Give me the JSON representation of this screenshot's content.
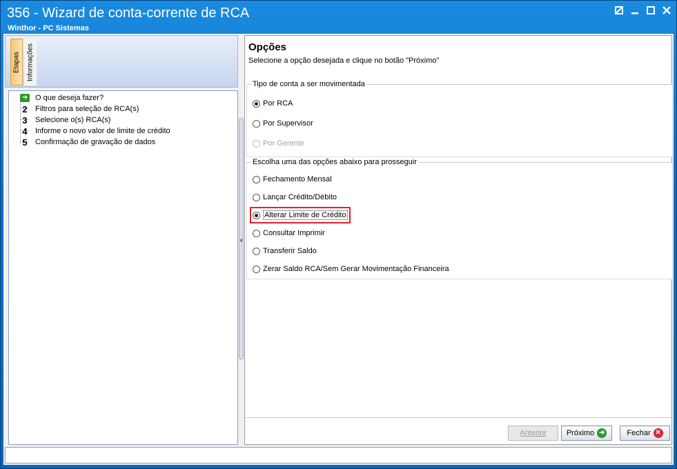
{
  "window": {
    "title": "356 - Wizard de conta-corrente de RCA",
    "subtitle": "Winthor - PC Sistemas"
  },
  "left_tabs": [
    "Etapas",
    "Informações"
  ],
  "steps": [
    {
      "marker": "arrow",
      "label": "O que deseja fazer?"
    },
    {
      "marker": "2",
      "label": "Filtros para seleção de RCA(s)"
    },
    {
      "marker": "3",
      "label": "Selecione o(s) RCA(s)"
    },
    {
      "marker": "4",
      "label": "Informe o novo valor de limite de crédito"
    },
    {
      "marker": "5",
      "label": "Confirmação de gravação de dados"
    }
  ],
  "main": {
    "title": "Opções",
    "subtitle": "Selecione a opção desejada e clique no botão \"Próximo\"",
    "group1": {
      "label": "Tipo de conta a ser movimentada",
      "options": [
        {
          "label": "Por RCA",
          "checked": true,
          "disabled": false
        },
        {
          "label": "Por Supervisor",
          "checked": false,
          "disabled": false
        },
        {
          "label": "Por Gerente",
          "checked": false,
          "disabled": true
        }
      ]
    },
    "group2": {
      "label": "Escolha uma das opções abaixo para prosseguir",
      "options": [
        {
          "label": "Fechamento Mensal",
          "checked": false
        },
        {
          "label": "Lançar Crédito/Débito",
          "checked": false
        },
        {
          "label": "Alterar Limite de Crédito",
          "checked": true
        },
        {
          "label": "Consultar Imprimir",
          "checked": false
        },
        {
          "label": "Transferir Saldo",
          "checked": false
        },
        {
          "label": "Zerar Saldo RCA/Sem Gerar Movimentação Financeira",
          "checked": false
        }
      ]
    }
  },
  "buttons": {
    "back": "Anterior",
    "next": "Próximo",
    "close": "Fechar"
  },
  "colors": {
    "title_bar": "#0a6fc6",
    "highlight": "#e0202a",
    "next_icon": "#2a9a2a",
    "close_icon": "#d9262c"
  }
}
